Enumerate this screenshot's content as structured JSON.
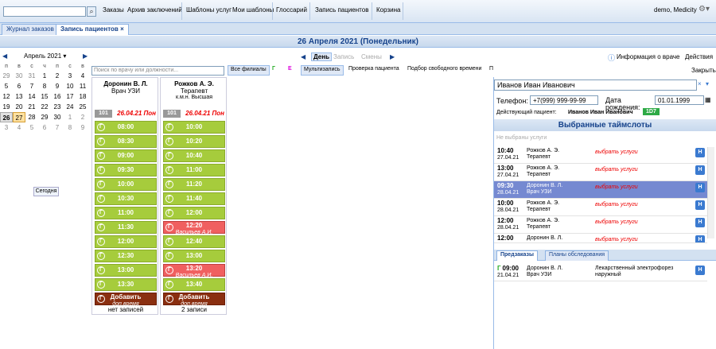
{
  "topbar": {
    "search_value": "",
    "search_icon": "search-icon",
    "orders": "Заказы",
    "archive": "Архив заключений",
    "service_templates": "Шаблоны услуг",
    "my_templates": "Мои шаблоны",
    "glossary": "Глоссарий",
    "patient_booking": "Запись пациентов",
    "cart": "Корзина",
    "user": "demo, Medicity",
    "gear_icon": "gear-icon"
  },
  "tabs": {
    "orders_log": "Журнал заказов",
    "booking": "Запись пациентов",
    "close": "×"
  },
  "datebar": {
    "title": "26 Апреля 2021 (Понедельник)"
  },
  "calendar": {
    "month": "Апрель 2021",
    "weekdays": [
      "п",
      "в",
      "с",
      "ч",
      "п",
      "с",
      "в"
    ],
    "rows": [
      [
        "29",
        "30",
        "31",
        "1",
        "2",
        "3",
        "4"
      ],
      [
        "5",
        "6",
        "7",
        "8",
        "9",
        "10",
        "11"
      ],
      [
        "12",
        "13",
        "14",
        "15",
        "16",
        "17",
        "18"
      ],
      [
        "19",
        "20",
        "21",
        "22",
        "23",
        "24",
        "25"
      ],
      [
        "26",
        "27",
        "28",
        "29",
        "30",
        "1",
        "2"
      ],
      [
        "3",
        "4",
        "5",
        "6",
        "7",
        "8",
        "9"
      ]
    ],
    "today_btn": "Сегодня"
  },
  "toolbar": {
    "day": "День",
    "booking": "Запись",
    "shifts": "Смены",
    "doctor_info": "Информация о враче",
    "actions": "Действия",
    "close": "Закрыть"
  },
  "filters": {
    "doc_search_placeholder": "Поиск по врачу или должности...",
    "all_branches": "Все филиалы",
    "g": "Г",
    "e": "Е",
    "multi": "Мультизапись",
    "check": "Проверка пациента",
    "free": "Подбор свободного времени",
    "more": "П"
  },
  "doctors": [
    {
      "name": "Доронин В. Л.",
      "role": "Врач УЗИ",
      "role2": "",
      "badge": "101",
      "date": "26.04.21 Пон",
      "count": "нет записей",
      "slots": [
        {
          "t": "08:00"
        },
        {
          "t": "08:30"
        },
        {
          "t": "09:00"
        },
        {
          "t": "09:30"
        },
        {
          "t": "10:00"
        },
        {
          "t": "10:30"
        },
        {
          "t": "11:00"
        },
        {
          "t": "11:30"
        },
        {
          "t": "12:00"
        },
        {
          "t": "12:30"
        },
        {
          "t": "13:00"
        },
        {
          "t": "13:30"
        }
      ]
    },
    {
      "name": "Рожков А. Э.",
      "role": "Терапевт",
      "role2": "к.м.н. Высшая",
      "badge": "101",
      "date": "26.04.21 Пон",
      "count": "2 записи",
      "slots": [
        {
          "t": "10:00"
        },
        {
          "t": "10:20"
        },
        {
          "t": "10:40"
        },
        {
          "t": "11:00"
        },
        {
          "t": "11:20"
        },
        {
          "t": "11:40"
        },
        {
          "t": "12:00"
        },
        {
          "t": "12:20",
          "who": "Васильев А.И."
        },
        {
          "t": "12:40"
        },
        {
          "t": "13:00"
        },
        {
          "t": "13:20",
          "who": "Васильев А.И."
        },
        {
          "t": "13:40"
        }
      ]
    }
  ],
  "add": {
    "label": "Добавить",
    "sub": "доп.время"
  },
  "slot_g": "Г",
  "patient": {
    "name": "Иванов Иван Иванович",
    "phone_label": "Телефон:",
    "phone": "+7(999) 999-99-99",
    "dob_label": "Дата рождения:",
    "dob": "01.01.1999",
    "active_label": "Действующий пациент:",
    "active": "Иванов Иван Иванович",
    "badge": "1D7"
  },
  "timeslots": {
    "title": "Выбранные таймслоты",
    "empty": "Не выбраны услуги",
    "rows": [
      {
        "time": "10:40",
        "date": "27.04.21",
        "doc": "Рожков А. Э.",
        "role": "Терапевт",
        "act": "выбрать услуги"
      },
      {
        "time": "13:00",
        "date": "27.04.21",
        "doc": "Рожков А. Э.",
        "role": "Терапевт",
        "act": "выбрать услуги"
      },
      {
        "time": "09:30",
        "date": "28.04.21",
        "doc": "Доронин В. Л.",
        "role": "Врач УЗИ",
        "act": "выбрать услуги"
      },
      {
        "time": "10:00",
        "date": "28.04.21",
        "doc": "Рожков А. Э.",
        "role": "Терапевт",
        "act": "выбрать услуги"
      },
      {
        "time": "12:00",
        "date": "28.04.21",
        "doc": "Рожков А. Э.",
        "role": "Терапевт",
        "act": "выбрать услуги"
      },
      {
        "time": "12:00",
        "date": "",
        "doc": "Доронин В. Л.",
        "role": "",
        "act": "выбрать услуги"
      }
    ],
    "h": "Н"
  },
  "pretabs": {
    "preorders": "Предзаказы",
    "plans": "Планы обследования"
  },
  "preorder": {
    "g": "Г",
    "time": "09:00",
    "date": "21.04.21",
    "doc": "Доронин В. Л.",
    "role": "Врач УЗИ",
    "service": "Лекарственный электрофорез",
    "service2": "наружный",
    "h": "Н"
  }
}
